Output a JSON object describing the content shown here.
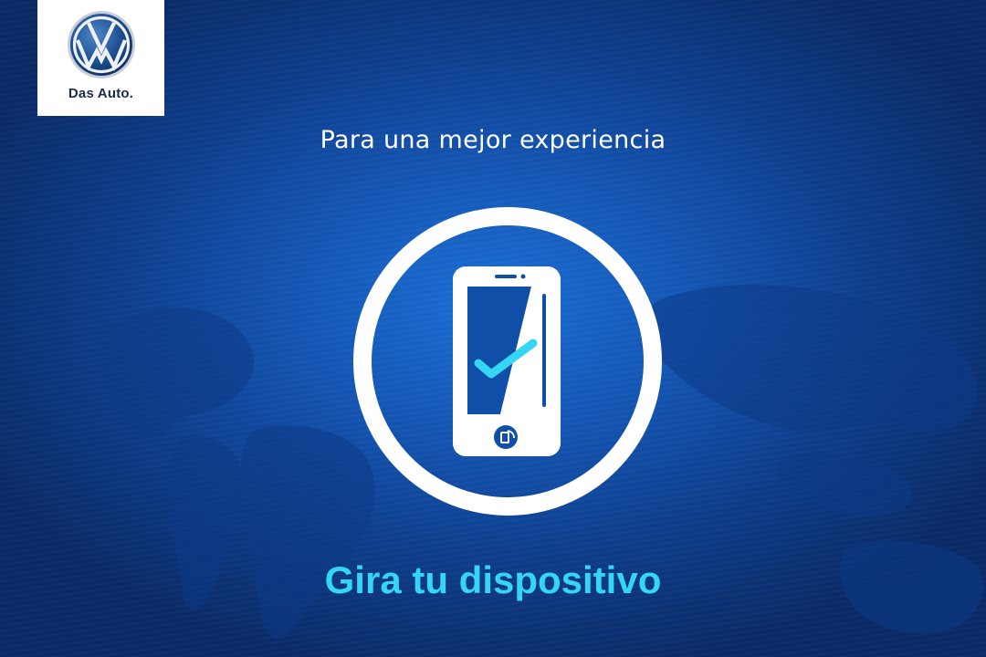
{
  "brand": {
    "tagline": "Das Auto.",
    "emblem": "vw-logo-icon"
  },
  "message": {
    "subtitle": "Para una mejor experiencia",
    "cta": "Gira tu dispositivo"
  },
  "icons": {
    "main": "rotate-device-icon",
    "check": "checkmark-icon",
    "home_button": "rotate-arrow-icon",
    "background": "world-map-icon"
  },
  "colors": {
    "background": "#1456b4",
    "accent": "#35d6f5",
    "white": "#ffffff"
  }
}
